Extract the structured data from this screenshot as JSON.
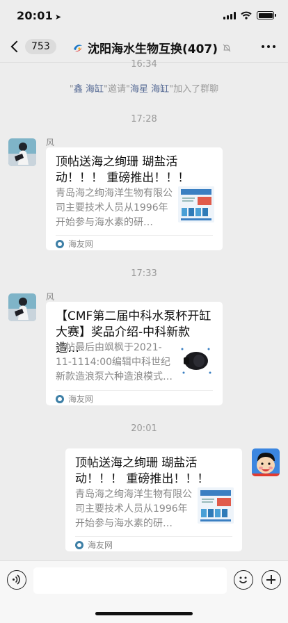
{
  "status": {
    "time": "20:01"
  },
  "nav": {
    "unread_count": "753",
    "title": "沈阳海水生物互换(407)"
  },
  "system_time": "16:34",
  "system_message": {
    "quote_open": "\"",
    "inviter": "鑫 海缸",
    "middle": "\"邀请\"",
    "invitee": "海星 海缸",
    "tail": "\"加入了群聊"
  },
  "messages": [
    {
      "time": "17:28",
      "sender": "风",
      "title": "顶帖送海之绚珊 瑚盐活动！！！ 重磅推出！！！",
      "desc": "青岛海之绚海洋生物有限公司主要技术人员从1996年开始参与海水素的研…",
      "source": "海友网",
      "thumb": "salt-products-thumbnail"
    },
    {
      "time": "17:33",
      "sender": "风",
      "title": "【CMF第二届中科水泵杯开缸大赛】奖品介绍-中科新款造…",
      "desc": "本帖最后由飒枫于2021-11-1114:00编辑中科世纪新款造浪泵六种造浪模式…",
      "source": "海友网",
      "thumb": "wave-pump-thumbnail"
    },
    {
      "time": "20:01",
      "sender": "",
      "title": "顶帖送海之绚珊 瑚盐活动！！！ 重磅推出！！！",
      "desc": "青岛海之绚海洋生物有限公司主要技术人员从1996年开始参与海水素的研…",
      "source": "海友网",
      "thumb": "salt-products-thumbnail"
    }
  ],
  "icons": {
    "back": "chevron-left-icon",
    "mute": "bell-muted-icon",
    "more": "ellipsis-icon",
    "voice": "voice-icon",
    "emoji": "emoji-icon",
    "plus": "plus-icon"
  }
}
